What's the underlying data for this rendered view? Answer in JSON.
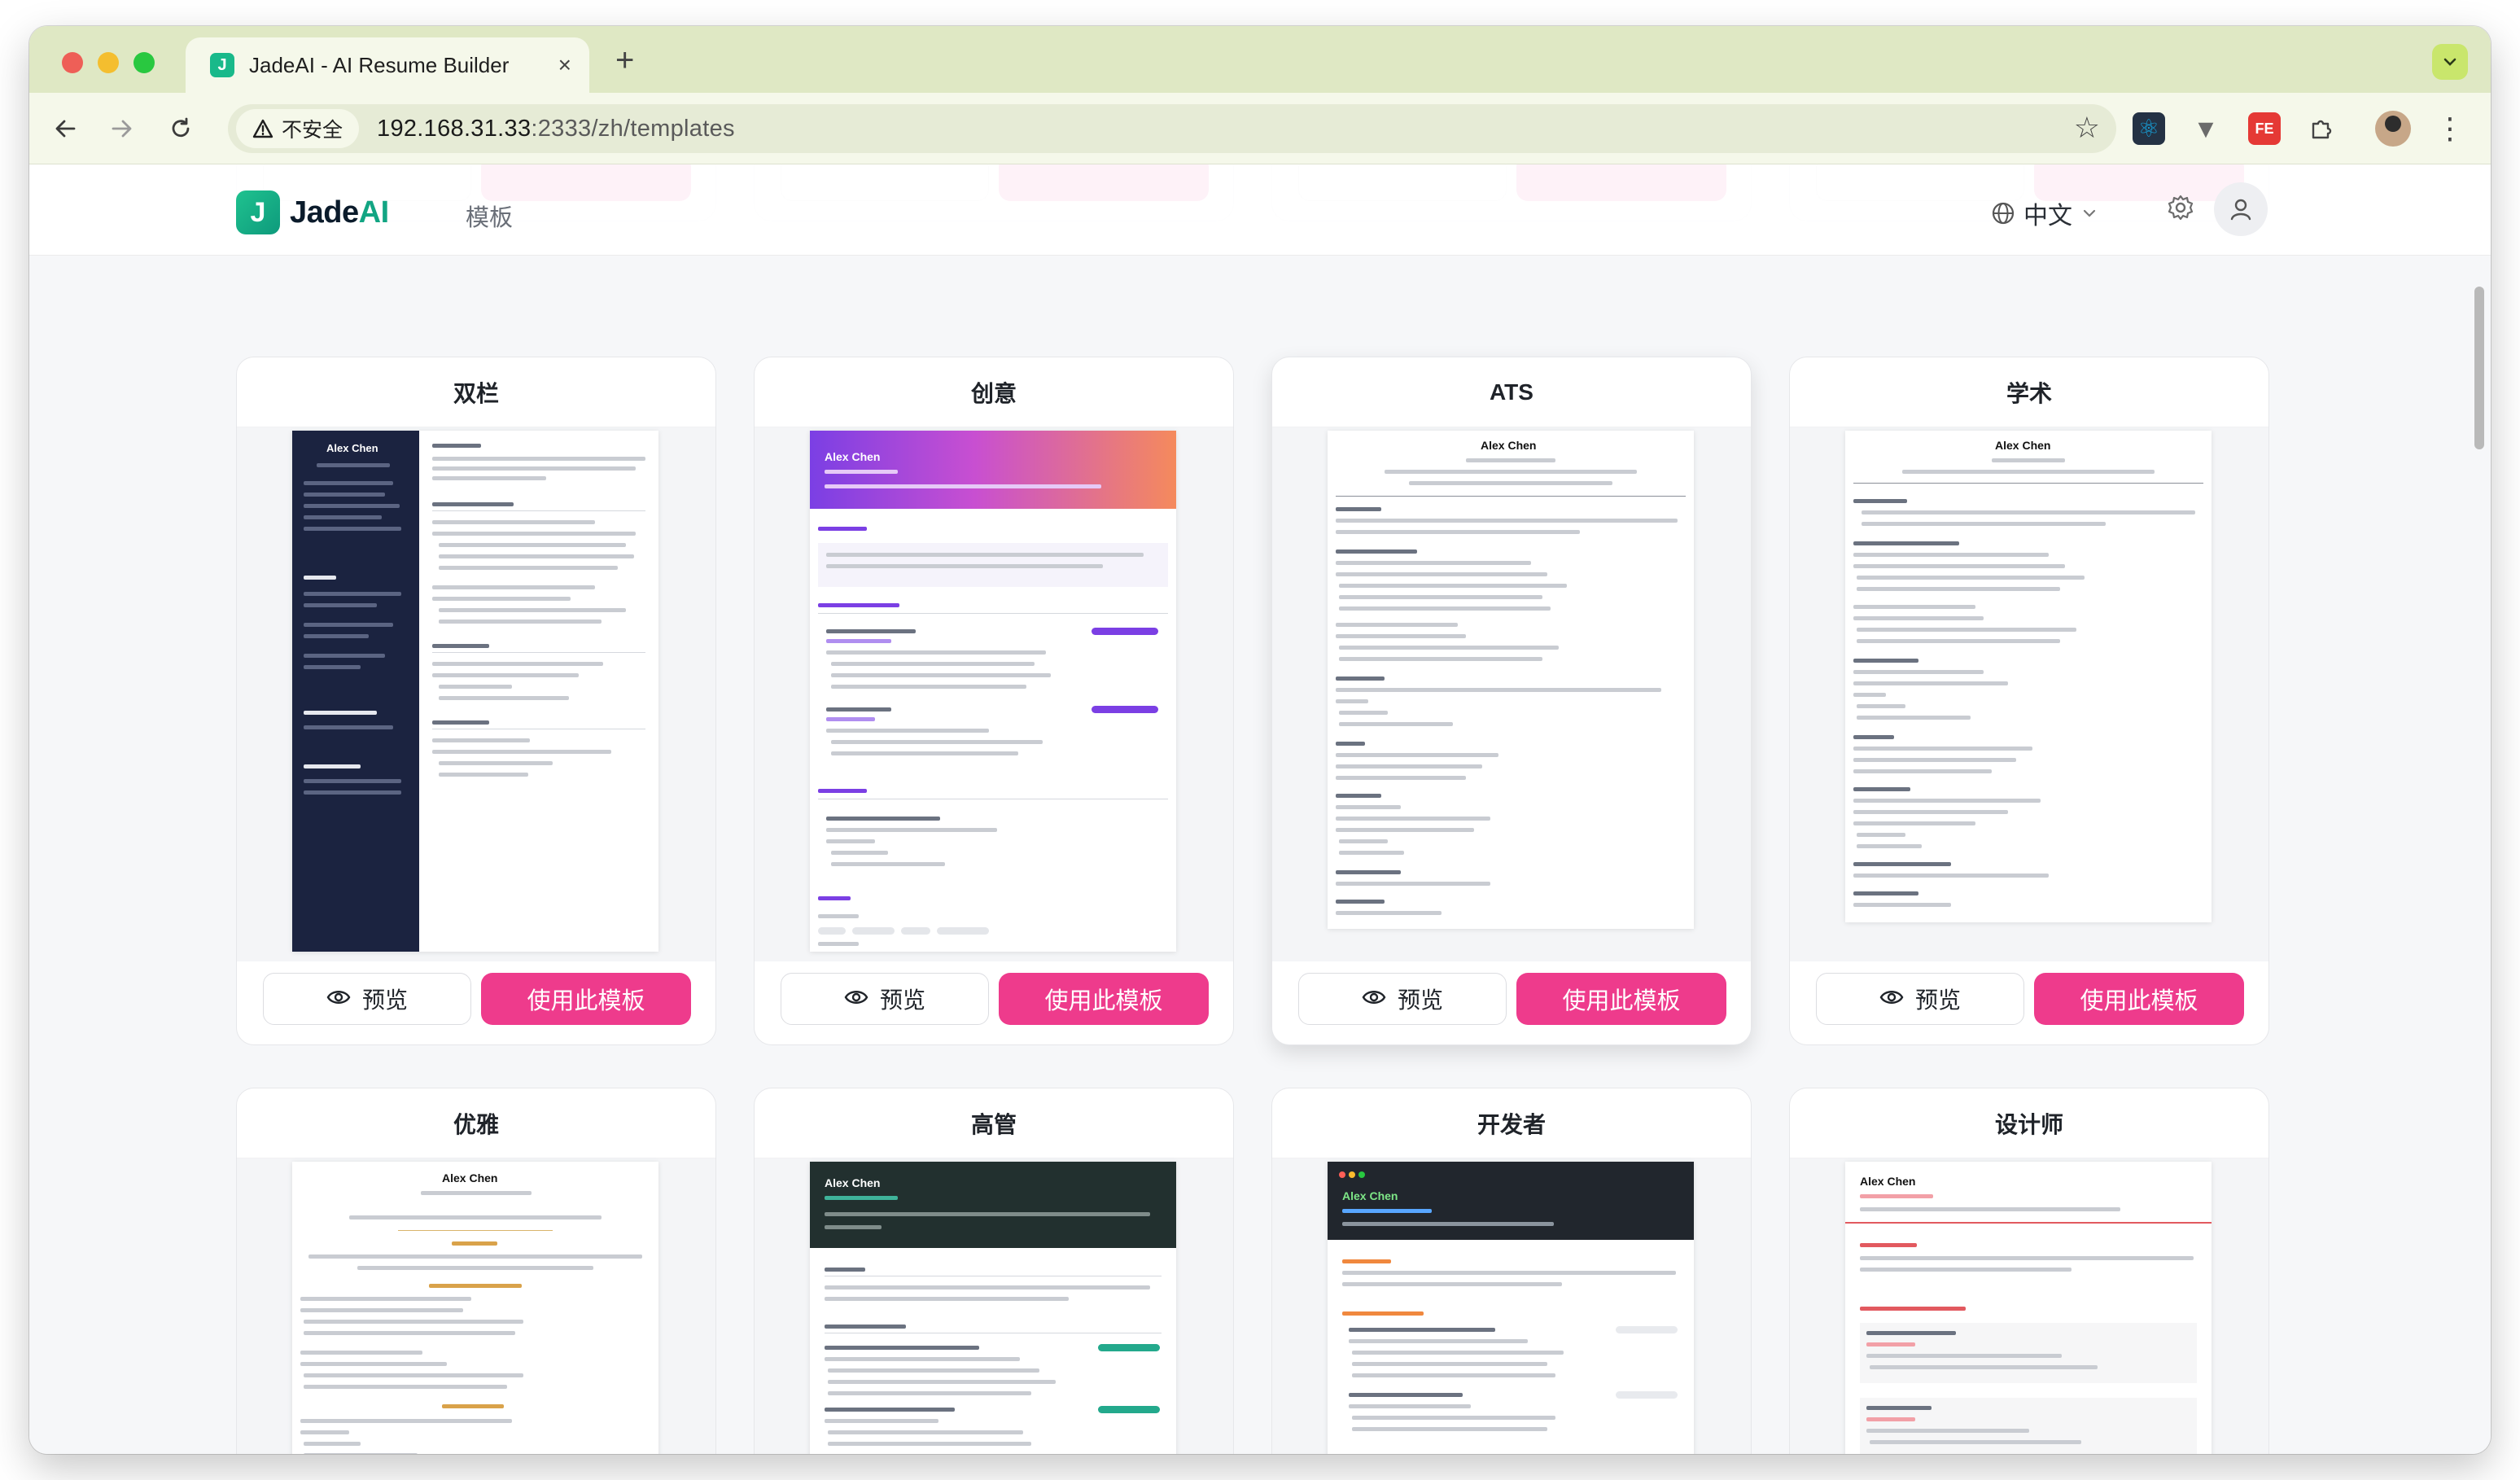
{
  "browser": {
    "tab_title": "JadeAI - AI Resume Builder",
    "tab_favicon": "J",
    "tab_close": "×",
    "new_tab": "+",
    "security_label": "不安全",
    "url_host": "192.168.31.33",
    "url_path": ":2333/zh/templates"
  },
  "header": {
    "brand_mark": "J",
    "brand_prefix": "Jade",
    "brand_suffix": "AI",
    "nav_templates": "模板",
    "language": "中文"
  },
  "buttons": {
    "preview": "预览",
    "use_template": "使用此模板"
  },
  "resume_sample": {
    "name": "Alex Chen"
  },
  "templates_row1": [
    {
      "title": "双栏"
    },
    {
      "title": "创意"
    },
    {
      "title": "ATS"
    },
    {
      "title": "学术"
    }
  ],
  "templates_row2": [
    {
      "title": "优雅"
    },
    {
      "title": "高管"
    },
    {
      "title": "开发者"
    },
    {
      "title": "设计师"
    }
  ],
  "colors": {
    "accent_pink": "#ee3b8c",
    "brand_green": "#12a583",
    "tab_strip": "#dfe8c4"
  }
}
